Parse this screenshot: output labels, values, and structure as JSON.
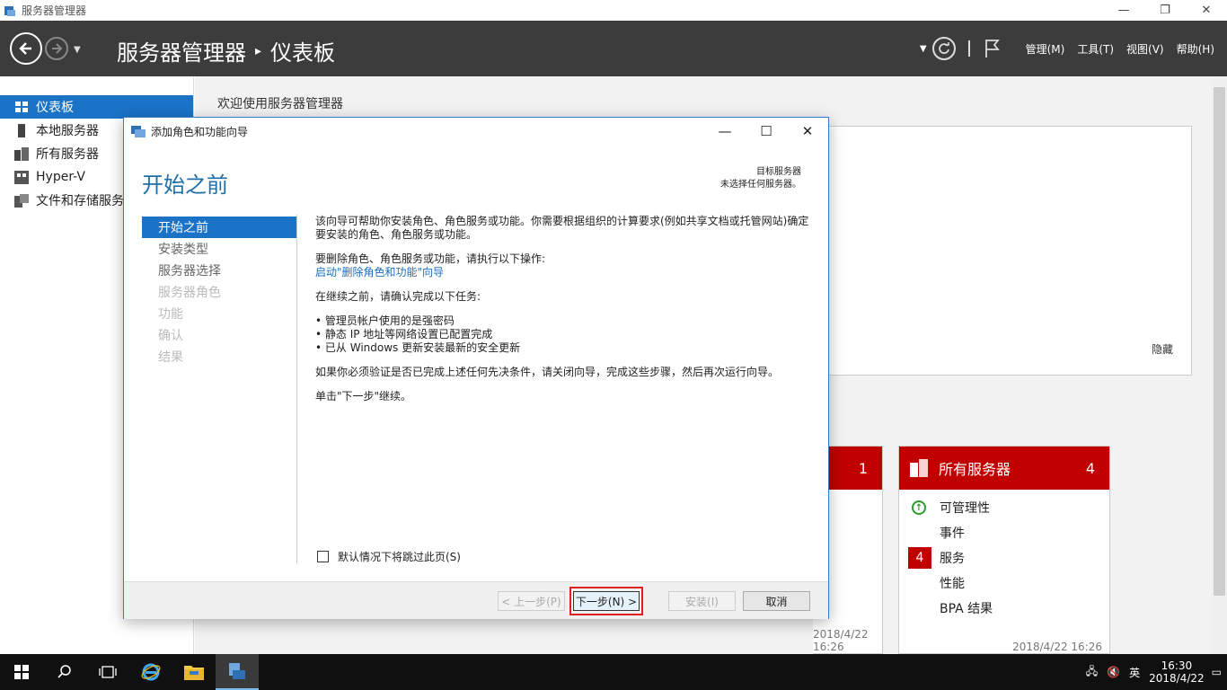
{
  "window": {
    "title": "服务器管理器"
  },
  "header": {
    "breadcrumb_root": "服务器管理器",
    "breadcrumb_page": "仪表板",
    "menus": [
      "管理(M)",
      "工具(T)",
      "视图(V)",
      "帮助(H)"
    ]
  },
  "sidebar": {
    "items": [
      {
        "label": "仪表板",
        "icon": "dashboard-icon",
        "active": true
      },
      {
        "label": "本地服务器",
        "icon": "server-icon"
      },
      {
        "label": "所有服务器",
        "icon": "servers-icon"
      },
      {
        "label": "Hyper-V",
        "icon": "hyperv-icon"
      },
      {
        "label": "文件和存储服务",
        "icon": "storage-icon"
      }
    ]
  },
  "main": {
    "welcome": "欢迎使用服务器管理器",
    "hide": "隐藏",
    "tile_partial": {
      "count": "1",
      "timestamp": "2018/4/22 16:26"
    },
    "tile_all_servers": {
      "title": "所有服务器",
      "count": "4",
      "rows": [
        {
          "label": "可管理性",
          "status": "ok"
        },
        {
          "label": "事件"
        },
        {
          "label": "服务",
          "badge": "4"
        },
        {
          "label": "性能"
        },
        {
          "label": "BPA 结果"
        }
      ],
      "timestamp": "2018/4/22 16:26"
    }
  },
  "dialog": {
    "title": "添加角色和功能向导",
    "heading": "开始之前",
    "target_label": "目标服务器",
    "target_value": "未选择任何服务器。",
    "steps": [
      {
        "label": "开始之前",
        "state": "active"
      },
      {
        "label": "安装类型",
        "state": "enabled"
      },
      {
        "label": "服务器选择",
        "state": "enabled"
      },
      {
        "label": "服务器角色",
        "state": "disabled"
      },
      {
        "label": "功能",
        "state": "disabled"
      },
      {
        "label": "确认",
        "state": "disabled"
      },
      {
        "label": "结果",
        "state": "disabled"
      }
    ],
    "para1": "该向导可帮助你安装角色、角色服务或功能。你需要根据组织的计算要求(例如共享文档或托管网站)确定要安装的角色、角色服务或功能。",
    "para2": "要删除角色、角色服务或功能，请执行以下操作:",
    "remove_link": "启动\"删除角色和功能\"向导",
    "para3": "在继续之前，请确认完成以下任务:",
    "bullets": [
      "管理员帐户使用的是强密码",
      "静态 IP 地址等网络设置已配置完成",
      "已从 Windows 更新安装最新的安全更新"
    ],
    "para4": "如果你必须验证是否已完成上述任何先决条件，请关闭向导，完成这些步骤，然后再次运行向导。",
    "para5": "单击\"下一步\"继续。",
    "skip_label": "默认情况下将跳过此页(S)",
    "buttons": {
      "prev": "< 上一步(P)",
      "next": "下一步(N) >",
      "install": "安装(I)",
      "cancel": "取消"
    }
  },
  "taskbar": {
    "ime": "英",
    "time": "16:30",
    "date": "2018/4/22"
  }
}
